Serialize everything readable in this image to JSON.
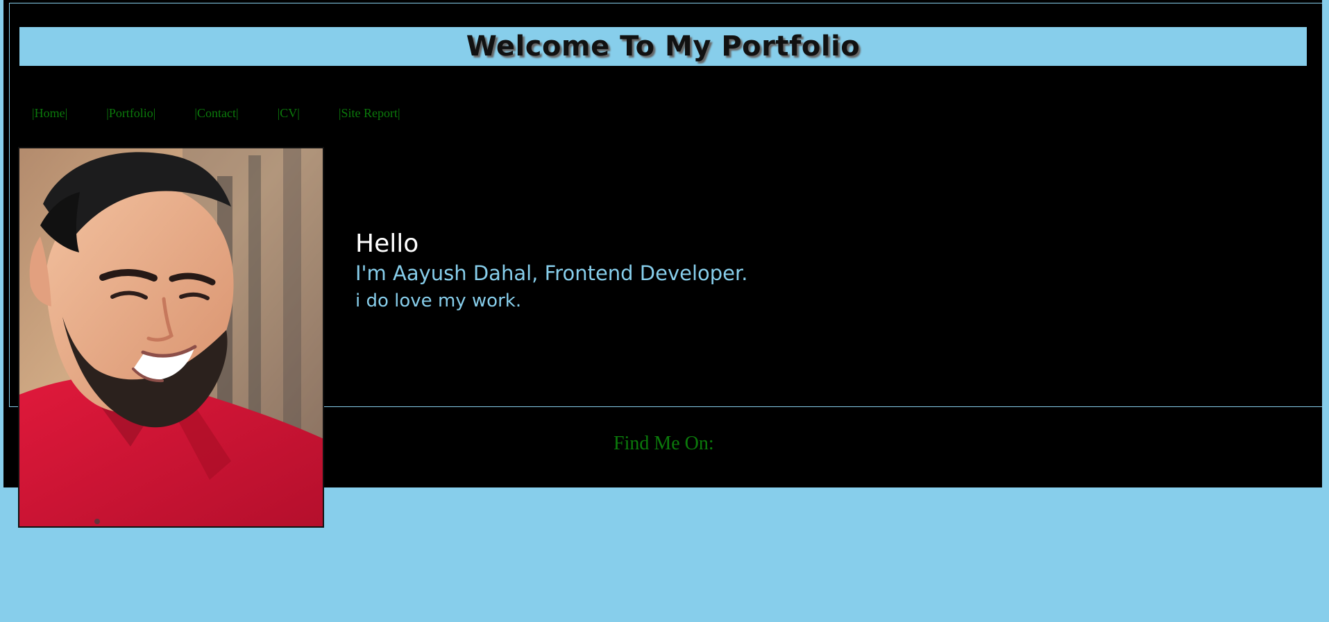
{
  "header": {
    "title": "Welcome To My Portfolio"
  },
  "nav": {
    "items": [
      {
        "label": "|Home|"
      },
      {
        "label": "|Portfolio|"
      },
      {
        "label": "|Contact|"
      },
      {
        "label": "|CV|"
      },
      {
        "label": "|Site Report|"
      }
    ]
  },
  "intro": {
    "greeting": "Hello",
    "headline": "I'm Aayush Dahal, Frontend Developer.",
    "subline": "i do love my work."
  },
  "footer": {
    "find_me_label": "Find Me On:"
  },
  "colors": {
    "page_background": "#87ceeb",
    "panel_background": "#000000",
    "header_background": "#87ceeb",
    "nav_link": "#0b7a0b",
    "intro_accent": "#87ceeb",
    "greeting": "#ffffff"
  }
}
